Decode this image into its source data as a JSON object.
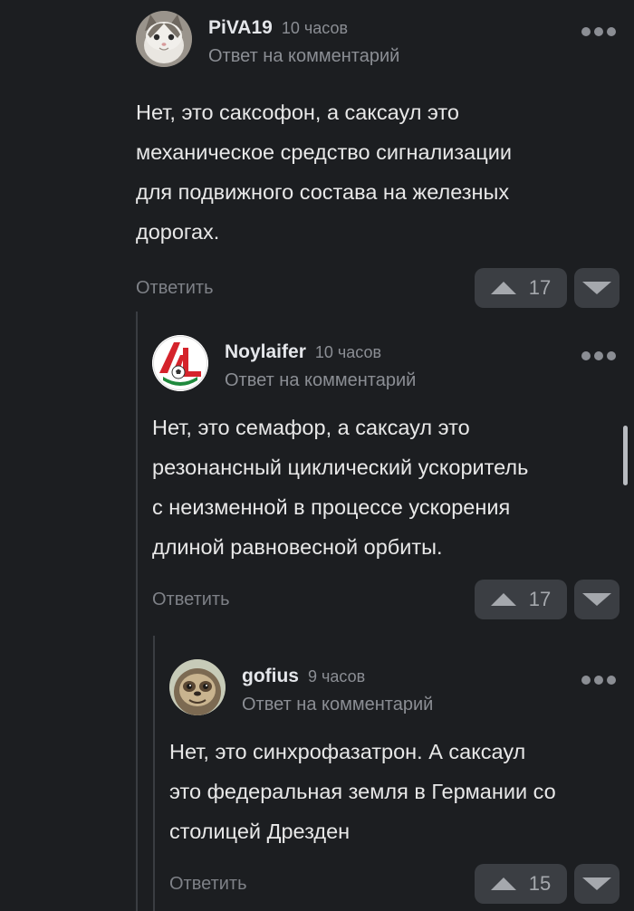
{
  "comments": [
    {
      "author": "PiVA19",
      "time": "10 часов",
      "reply_label": "Ответ на комментарий",
      "text_lines": [
        "Нет, это саксофон, а саксаул это",
        "механическое средство сигнализации",
        "для подвижного состава на железных",
        "дорогах."
      ],
      "reply_button": "Ответить",
      "score": "17"
    },
    {
      "author": "Noylaifer",
      "time": "10 часов",
      "reply_label": "Ответ на комментарий",
      "text_lines": [
        "Нет, это семафор, а саксаул это",
        "резонансный циклический ускоритель",
        "с неизменной в процессе ускорения",
        "длиной равновесной орбиты."
      ],
      "reply_button": "Ответить",
      "score": "17"
    },
    {
      "author": "gofius",
      "time": "9 часов",
      "reply_label": "Ответ на комментарий",
      "text_lines": [
        "Нет, это синхрофазатрон. А саксаул",
        "это федеральная земля в Германии со",
        "столицей Дрезден"
      ],
      "reply_button": "Ответить",
      "score": "15"
    }
  ],
  "icons": {
    "more": "more-dots-icon",
    "upvote": "upvote-arrow-icon",
    "downvote": "downvote-arrow-icon"
  },
  "colors": {
    "background": "#1c1e21",
    "muted_text": "#8b8e94",
    "vote_bg": "#3b3e43",
    "club_red": "#d5232b",
    "club_green": "#1f8a3d"
  }
}
